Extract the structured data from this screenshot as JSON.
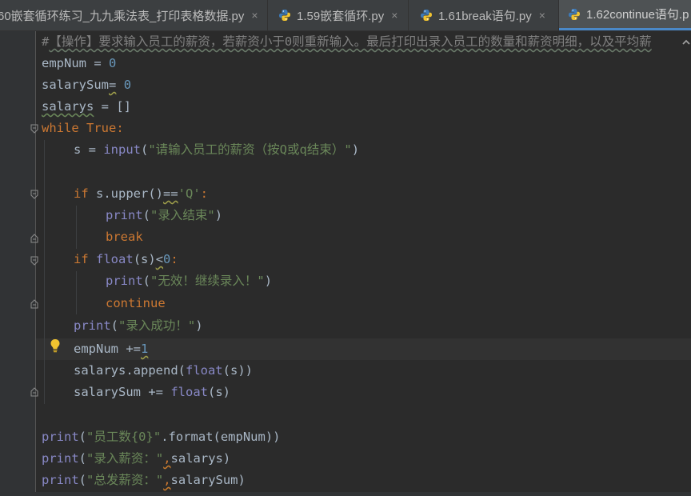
{
  "tabs": [
    {
      "label": "60嵌套循环练习_九九乘法表_打印表格数据.py",
      "icon": "",
      "closable": true,
      "active": false
    },
    {
      "label": "1.59嵌套循环.py",
      "icon": "python-file-icon",
      "closable": true,
      "active": false
    },
    {
      "label": "1.61break语句.py",
      "icon": "python-file-icon",
      "closable": true,
      "active": false
    },
    {
      "label": "1.62continue语句.p",
      "icon": "python-file-icon",
      "closable": false,
      "active": true
    }
  ],
  "close_glyph": "×",
  "code": {
    "line1": {
      "hash": "#",
      "text": "【操作】要求输入员工的薪资，若薪资小于0则重新输入。最后打印出录入员工的数量和薪资明细，以及平均薪"
    },
    "line2": {
      "a": "empNum",
      "b": " = ",
      "c": "0"
    },
    "line3": {
      "a": "salarySum",
      "b": "=",
      "c": " ",
      "d": "0"
    },
    "line4": {
      "a": "salarys",
      "b": " = []"
    },
    "line5": {
      "kw": "while",
      "sp": " ",
      "kw2": "True",
      "colon": ":"
    },
    "line6": {
      "a": "s = ",
      "fn": "input",
      "p1": "(",
      "str": "\"请输入员工的薪资（按Q或q结束）\"",
      "p2": ")"
    },
    "line8": {
      "kw": "if",
      "a": " s.upper()",
      "eq": "==",
      "str": "'Q'",
      "colon": ":"
    },
    "line9": {
      "fn": "print",
      "p1": "(",
      "str": "\"录入结束\"",
      "p2": ")"
    },
    "line10": {
      "kw": "break"
    },
    "line11": {
      "kw": "if",
      "sp": " ",
      "fn": "float",
      "a": "(s)",
      "lt": "<",
      "num": "0",
      "colon": ":"
    },
    "line12": {
      "fn": "print",
      "p1": "(",
      "str": "\"无效！继续录入！\"",
      "p2": ")"
    },
    "line13": {
      "kw": "continue"
    },
    "line14": {
      "fn": "print",
      "p1": "(",
      "str": "\"录入成功！\"",
      "p2": ")"
    },
    "line15": {
      "a": "empNum +=",
      "num": "1"
    },
    "line16": {
      "a": "salarys.append(",
      "fn": "float",
      "b": "(s))"
    },
    "line17": {
      "a": "salarySum += ",
      "fn": "float",
      "b": "(s)"
    },
    "line19": {
      "fn": "print",
      "p1": "(",
      "str": "\"员工数{0}\"",
      "a": ".format(empNum))"
    },
    "line20": {
      "fn": "print",
      "p1": "(",
      "str": "\"录入薪资：\"",
      "comma": ",",
      "a": "salarys)"
    },
    "line21": {
      "fn": "print",
      "p1": "(",
      "str": "\"总发薪资：\"",
      "comma": ",",
      "a": "salarySum)"
    }
  },
  "colors": {
    "keyword": "#cc7832",
    "builtin": "#8888c6",
    "string": "#6a8759",
    "number": "#6897bb",
    "comment": "#808080",
    "text": "#a9b7c6",
    "background": "#2b2b2b",
    "tab_accent": "#4a88c7"
  }
}
